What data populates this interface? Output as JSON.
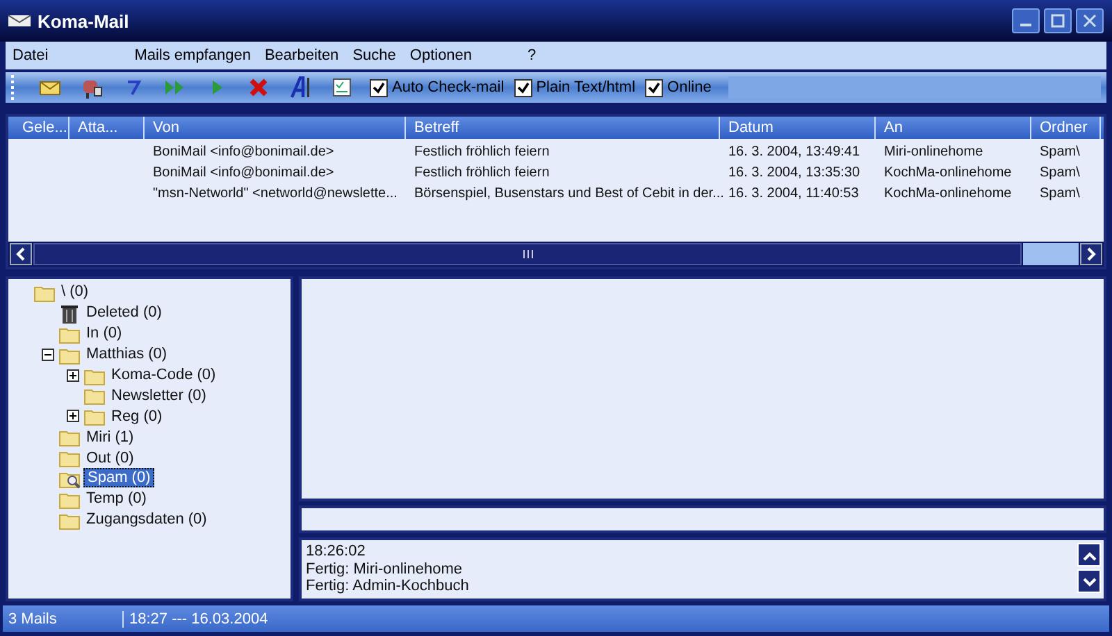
{
  "window": {
    "title": "Koma-Mail"
  },
  "menu": [
    "Datei",
    "Mails empfangen",
    "Bearbeiten",
    "Suche",
    "Optionen",
    "?"
  ],
  "toolbar_options": [
    {
      "label": "Auto Check-mail",
      "checked": true
    },
    {
      "label": "Plain Text/html",
      "checked": true
    },
    {
      "label": "Online",
      "checked": true
    }
  ],
  "table": {
    "columns": [
      "Gele...",
      "Atta...",
      "Von",
      "Betreff",
      "Datum",
      "An",
      "Ordner"
    ],
    "rows": [
      [
        "",
        "",
        "BoniMail <info@bonimail.de>",
        "Festlich fröhlich feiern",
        "16. 3. 2004, 13:49:41",
        "Miri-onlinehome",
        "Spam\\"
      ],
      [
        "",
        "",
        "BoniMail <info@bonimail.de>",
        "Festlich fröhlich feiern",
        "16. 3. 2004, 13:35:30",
        "KochMa-onlinehome",
        "Spam\\"
      ],
      [
        "",
        "",
        "\"msn-Networld\" <networld@newslette...",
        "Börsenspiel, Busenstars und Best of Cebit in der...",
        "16. 3. 2004, 11:40:53",
        "KochMa-onlinehome",
        "Spam\\"
      ]
    ]
  },
  "folders": [
    {
      "label": "\\ (0)",
      "kind": "folder",
      "selected": false,
      "children": [
        {
          "label": "Deleted (0)",
          "kind": "trash",
          "selected": false
        },
        {
          "label": "In (0)",
          "kind": "folder",
          "selected": false
        },
        {
          "label": "Matthias (0)",
          "kind": "folder",
          "selected": false,
          "expanded": true,
          "children": [
            {
              "label": "Koma-Code (0)",
              "kind": "folder",
              "selected": false,
              "expanded": false
            },
            {
              "label": "Newsletter (0)",
              "kind": "folder",
              "selected": false
            },
            {
              "label": "Reg (0)",
              "kind": "folder",
              "selected": false,
              "expanded": false
            }
          ]
        },
        {
          "label": "Miri (1)",
          "kind": "folder",
          "selected": false
        },
        {
          "label": "Out (0)",
          "kind": "folder",
          "selected": false
        },
        {
          "label": "Spam (0)",
          "kind": "search",
          "selected": true
        },
        {
          "label": "Temp (0)",
          "kind": "folder",
          "selected": false
        },
        {
          "label": "Zugangsdaten (0)",
          "kind": "folder",
          "selected": false
        }
      ]
    }
  ],
  "log": [
    "18:26:02",
    "Fertig: Miri-onlinehome",
    "Fertig: Admin-Kochbuch"
  ],
  "status_bar": [
    "3 Mails",
    "18:27 --- 16.03.2004"
  ]
}
